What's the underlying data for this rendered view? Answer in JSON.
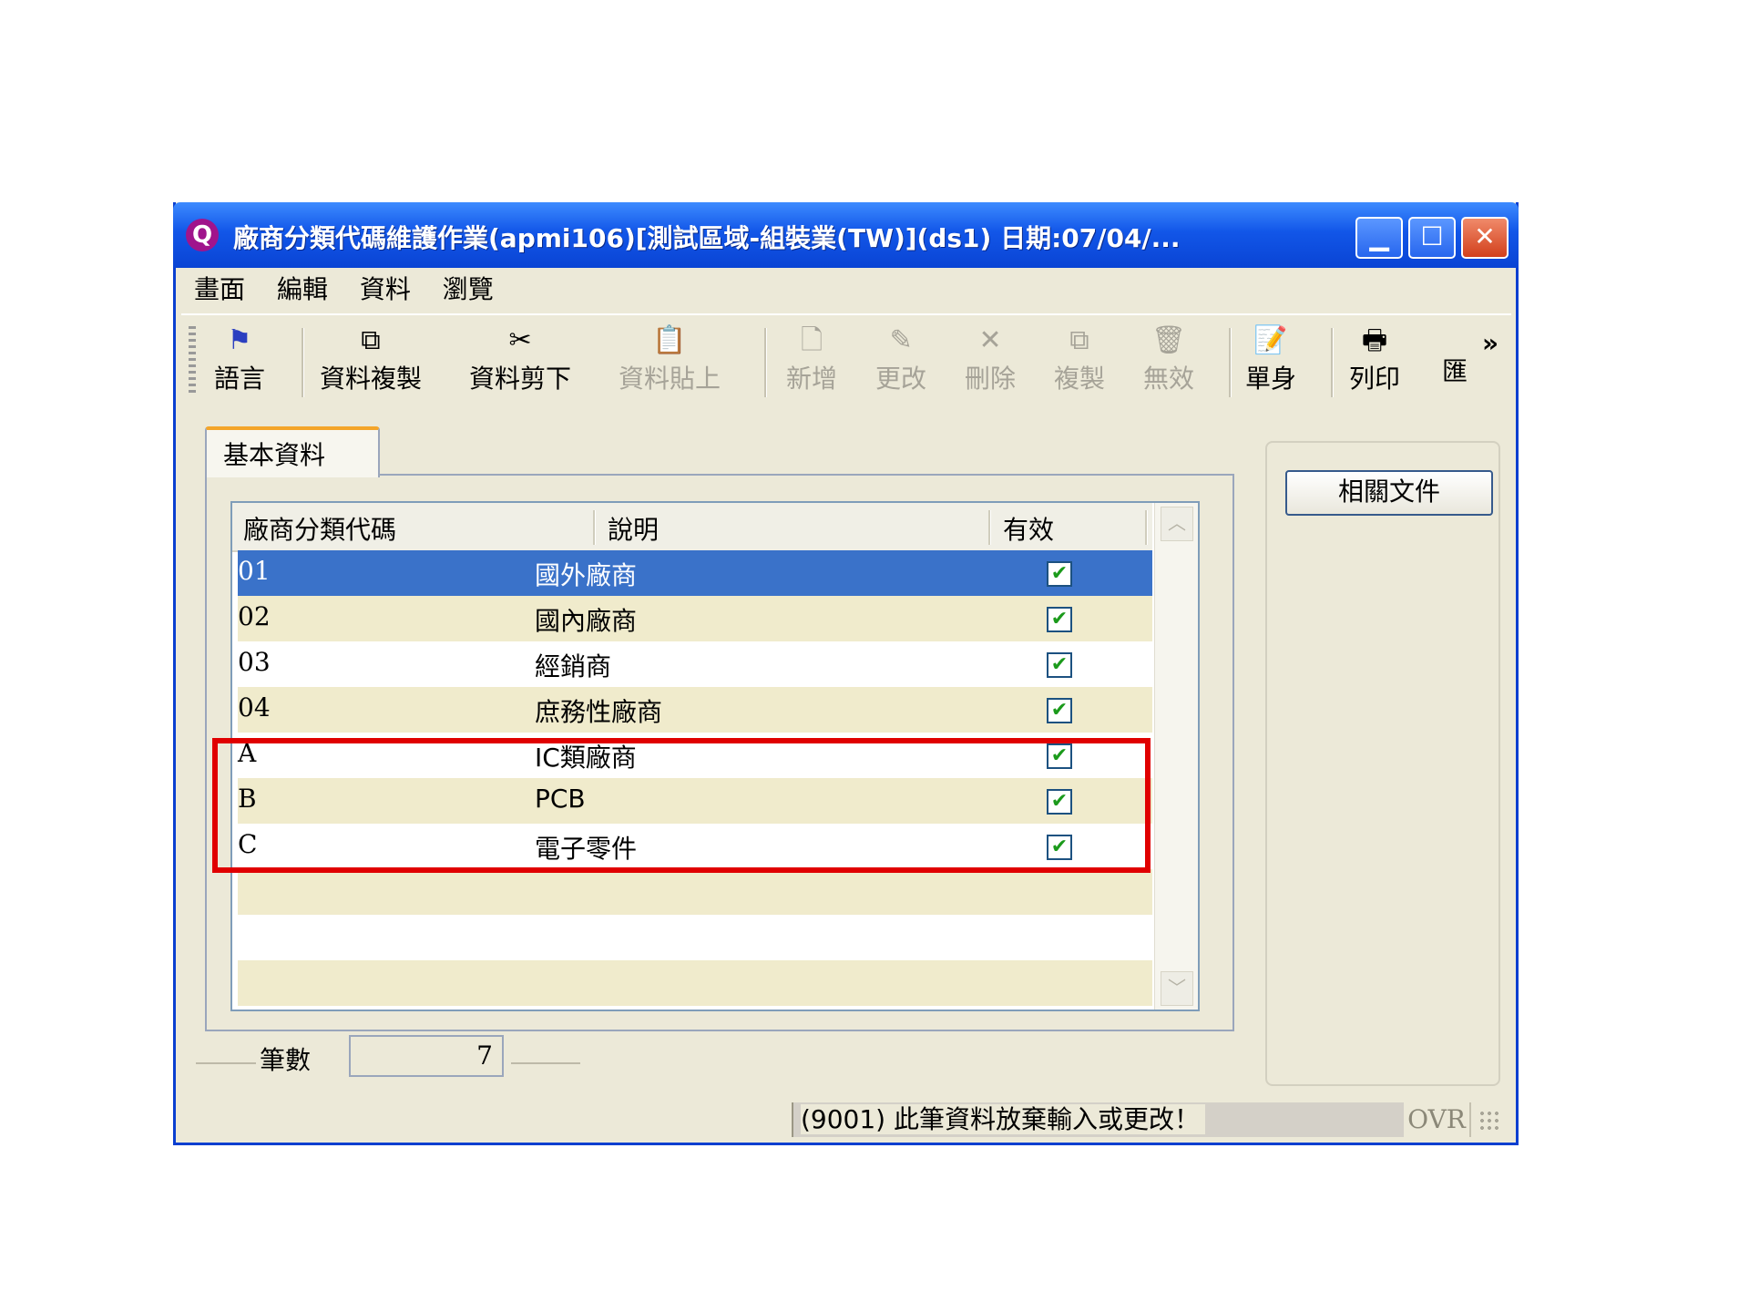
{
  "window": {
    "title": "廠商分類代碼維護作業(apmi106)[測試區域-組裝業(TW)](ds1) 日期:07/04/...",
    "icon_glyph": "Q"
  },
  "menu": [
    "畫面",
    "編輯",
    "資料",
    "瀏覽"
  ],
  "toolbar": {
    "language": "語言",
    "copy_data": "資料複製",
    "cut_data": "資料剪下",
    "paste_data": "資料貼上",
    "add": "新增",
    "modify": "更改",
    "delete": "刪除",
    "copy": "複製",
    "invalid": "無效",
    "single": "單身",
    "print": "列印",
    "export": "匯",
    "more": "»"
  },
  "tab": {
    "label": "基本資料"
  },
  "grid": {
    "columns": [
      "廠商分類代碼",
      "說明",
      "有效"
    ],
    "rows": [
      {
        "code": "01",
        "desc": "國外廠商",
        "valid": true
      },
      {
        "code": "02",
        "desc": "國內廠商",
        "valid": true
      },
      {
        "code": "03",
        "desc": "經銷商",
        "valid": true
      },
      {
        "code": "04",
        "desc": "庶務性廠商",
        "valid": true
      },
      {
        "code": "A",
        "desc": "IC類廠商",
        "valid": true
      },
      {
        "code": "B",
        "desc": "PCB",
        "valid": true
      },
      {
        "code": "C",
        "desc": "電子零件",
        "valid": true
      }
    ],
    "selected_row": 0
  },
  "side": {
    "related_docs": "相關文件"
  },
  "count": {
    "label": "筆數",
    "value": "7"
  },
  "status": {
    "message": "(9001) 此筆資料放棄輸入或更改！",
    "mode": "OVR"
  },
  "colors": {
    "title_blue": "#1256e8",
    "selected_row": "#3a72c9",
    "highlight_red": "#e00000",
    "row_alt": "#f0ebcc"
  }
}
